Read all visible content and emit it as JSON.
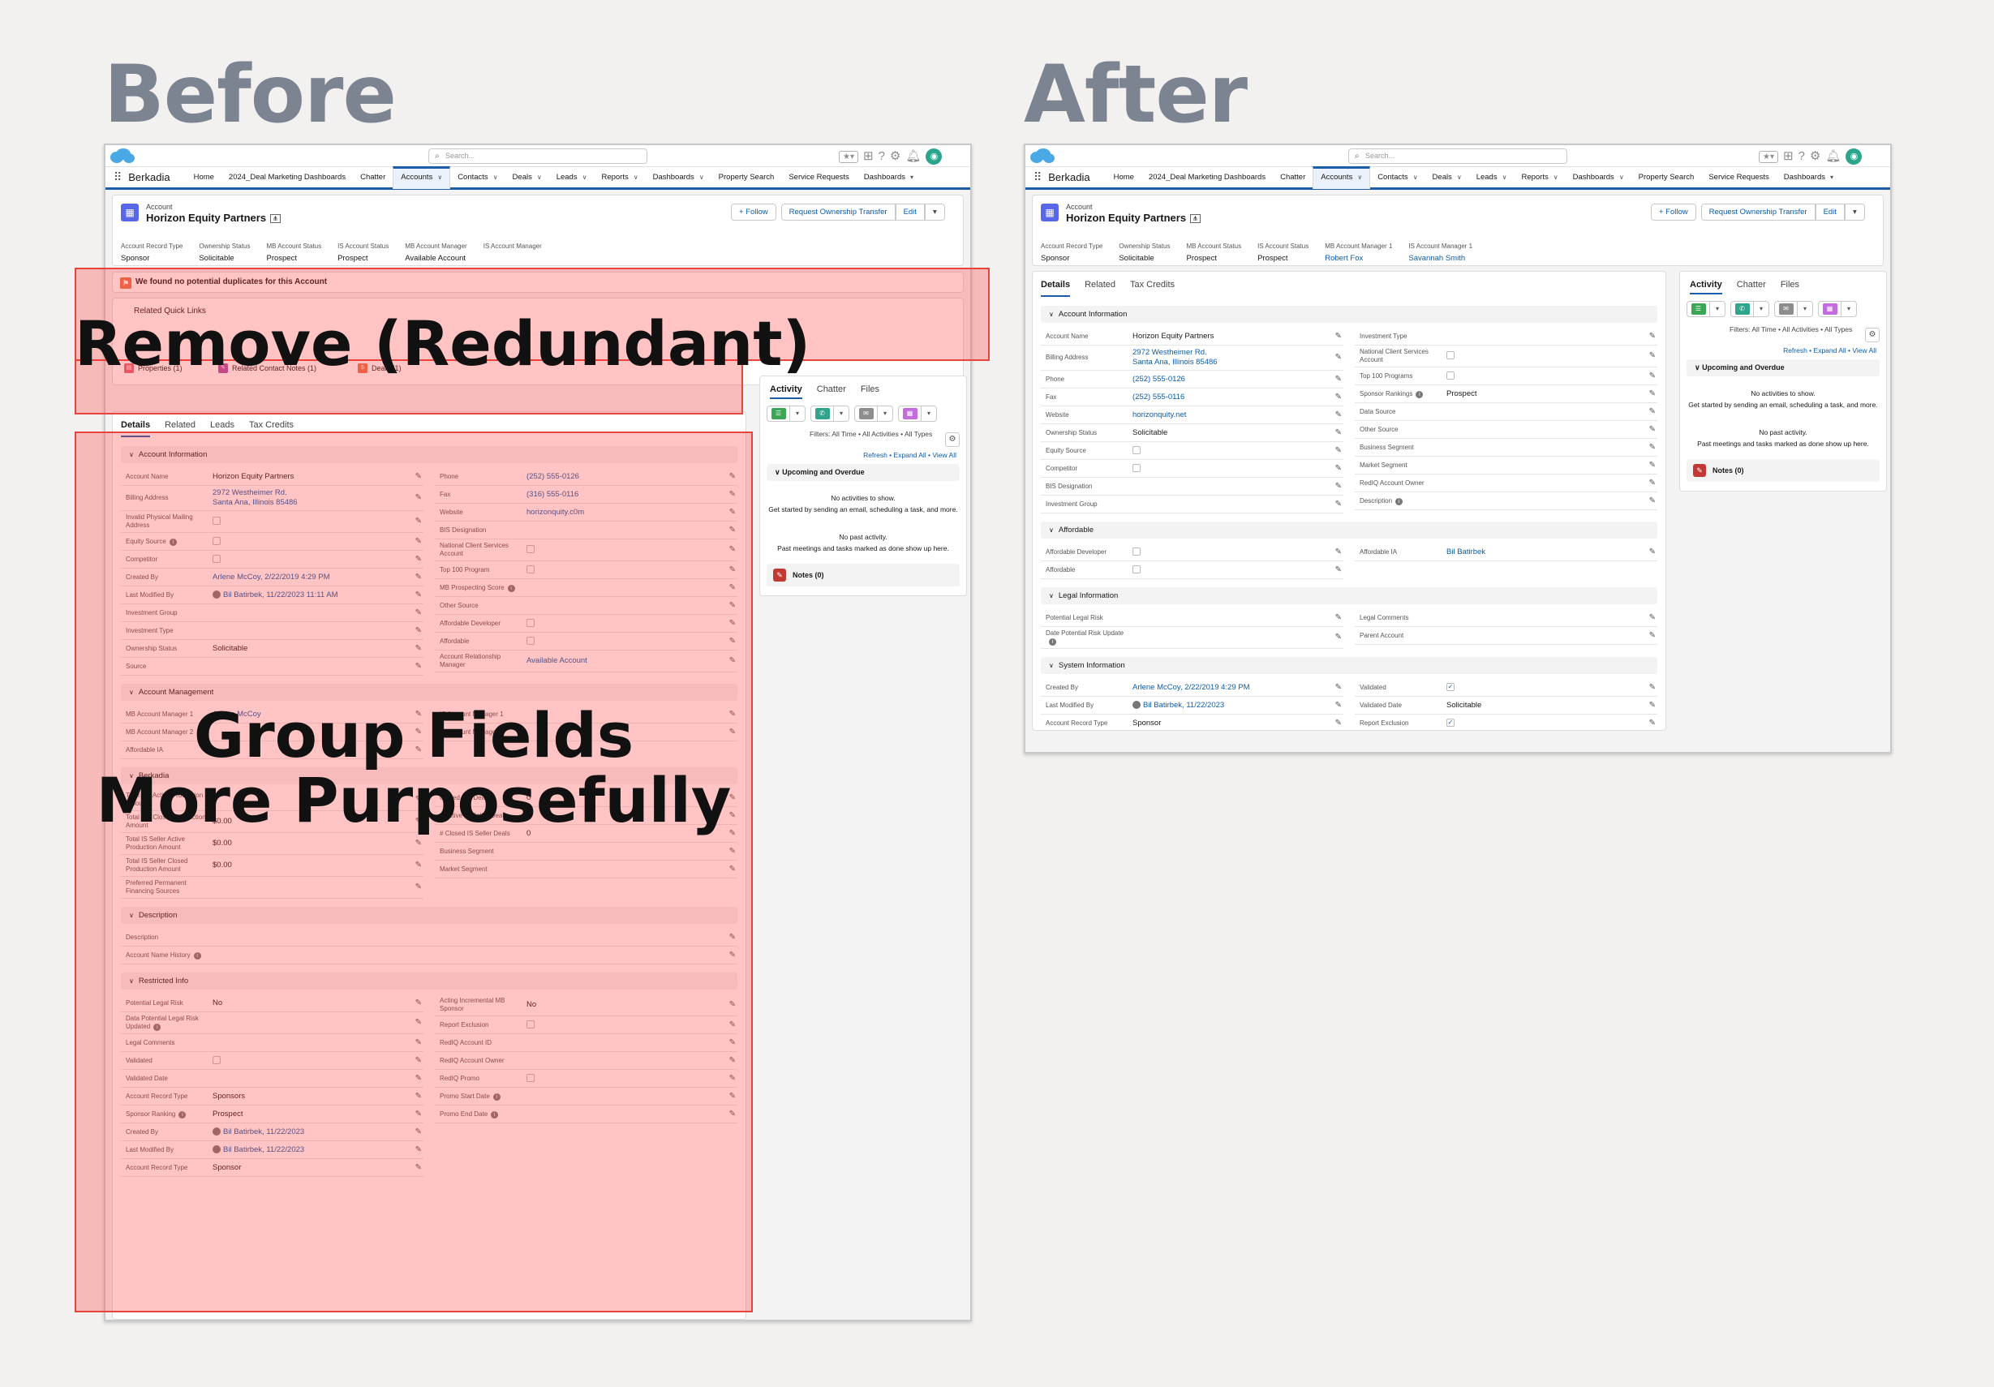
{
  "headings": {
    "before": "Before",
    "after": "After"
  },
  "app": {
    "name": "Berkadia",
    "search_placeholder": "Search...",
    "nav": [
      "Home",
      "2024_Deal Marketing Dashboards",
      "Chatter",
      "Accounts",
      "Contacts",
      "Deals",
      "Leads",
      "Reports",
      "Dashboards",
      "Property Search",
      "Service Requests",
      "Dashboards"
    ]
  },
  "record": {
    "type": "Account",
    "name": "Horizon Equity Partners",
    "buttons": {
      "follow": "+ Follow",
      "transfer": "Request Ownership Transfer",
      "edit": "Edit"
    }
  },
  "before": {
    "highlights": [
      {
        "label": "Account Record Type",
        "value": "Sponsor"
      },
      {
        "label": "Ownership Status",
        "value": "Solicitable"
      },
      {
        "label": "MB Account Status",
        "value": "Prospect"
      },
      {
        "label": "IS Account Status",
        "value": "Prospect"
      },
      {
        "label": "MB Account Manager",
        "value": "Available Account"
      },
      {
        "label": "IS Account Manager",
        "value": ""
      }
    ],
    "duplicate_banner": "We found no potential duplicates for this Account",
    "quick_links_title": "Related Quick Links",
    "quick_links": [
      "Properties (1)",
      "Related Contact Notes (1)",
      "Deals (1)"
    ],
    "tabs": [
      "Details",
      "Related",
      "Leads",
      "Tax Credits"
    ],
    "sections": {
      "account_info": "Account Information",
      "account_mgmt": "Account Management",
      "berkadia": "Berkadia",
      "description": "Description",
      "restricted": "Restricted Info"
    },
    "info_left": [
      {
        "label": "Account Name",
        "value": "Horizon Equity Partners"
      },
      {
        "label": "Billing Address",
        "value": "2972 Westheimer Rd.\nSanta Ana, Illinois 85486",
        "link": true
      },
      {
        "label": "Invalid Physical Mailing Address",
        "value": "",
        "cb": true
      },
      {
        "label": "Equity Source",
        "value": "",
        "cb": true,
        "info": true
      },
      {
        "label": "Competitor",
        "value": "",
        "cb": true
      },
      {
        "label": "Created By",
        "value": "Arlene McCoy, 2/22/2019 4:29 PM",
        "link": true
      },
      {
        "label": "Last Modified By",
        "value": "Bil Batirbek, 11/22/2023 11:11 AM",
        "link": true,
        "user": true
      },
      {
        "label": "Investment Group",
        "value": ""
      },
      {
        "label": "Investment Type",
        "value": ""
      },
      {
        "label": "Ownership Status",
        "value": "Solicitable"
      },
      {
        "label": "Source",
        "value": ""
      }
    ],
    "info_right": [
      {
        "label": "Phone",
        "value": "(252) 555-0126",
        "link": true
      },
      {
        "label": "Fax",
        "value": "(316) 555-0116",
        "link": true
      },
      {
        "label": "Website",
        "value": "horizonquity.c0m",
        "link": true
      },
      {
        "label": "BIS Designation",
        "value": ""
      },
      {
        "label": "National Client Services Account",
        "value": "",
        "cb": true
      },
      {
        "label": "Top 100 Program",
        "value": "",
        "cb": true
      },
      {
        "label": "MB Prospecting Score",
        "value": "",
        "info": true
      },
      {
        "label": "Other Source",
        "value": ""
      },
      {
        "label": "Affordable Developer",
        "value": "",
        "cb": true
      },
      {
        "label": "Affordable",
        "value": "",
        "cb": true
      },
      {
        "label": "Account Relationship Manager",
        "value": "Available Account",
        "link": true
      }
    ],
    "mgmt_left": [
      {
        "label": "MB Account Manager 1",
        "value": "Arlene McCoy",
        "link": true
      },
      {
        "label": "MB Account Manager 2",
        "value": ""
      },
      {
        "label": "Affordable IA",
        "value": ""
      }
    ],
    "mgmt_right": [
      {
        "label": "IS Account Manager 1",
        "value": ""
      },
      {
        "label": "IS Account Manager 2",
        "value": ""
      }
    ],
    "berk_left": [
      {
        "label": "Total MB Active Production Amount",
        "value": ""
      },
      {
        "label": "Total MB Closed Production Amount",
        "value": "$0.00"
      },
      {
        "label": "Total IS Seller Active Production Amount",
        "value": "$0.00"
      },
      {
        "label": "Total IS Seller Closed Production Amount",
        "value": "$0.00"
      },
      {
        "label": "Preferred Permanent Financing Sources",
        "value": ""
      }
    ],
    "berk_right": [
      {
        "label": "Closed MB Deals",
        "value": "0"
      },
      {
        "label": "# Active IS Seller Deals",
        "value": "0"
      },
      {
        "label": "# Closed IS Seller Deals",
        "value": "0"
      },
      {
        "label": "Business Segment",
        "value": ""
      },
      {
        "label": "Market Segment",
        "value": ""
      }
    ],
    "desc": [
      {
        "label": "Description",
        "value": ""
      },
      {
        "label": "Account Name History",
        "value": "",
        "info": true
      }
    ],
    "restr_left": [
      {
        "label": "Potential Legal Risk",
        "value": "No"
      },
      {
        "label": "Data Potential Legal Risk Updated",
        "value": "",
        "info": true
      },
      {
        "label": "Legal Comments",
        "value": ""
      },
      {
        "label": "Validated",
        "value": "",
        "cb": true
      },
      {
        "label": "Validated Date",
        "value": ""
      },
      {
        "label": "Account Record Type",
        "value": "Sponsors"
      },
      {
        "label": "Sponsor Ranking",
        "value": "Prospect",
        "info": true
      },
      {
        "label": "Created By",
        "value": "Bil Batirbek, 11/22/2023",
        "link": true,
        "user": true
      },
      {
        "label": "Last Modified By",
        "value": "Bil Batirbek, 11/22/2023",
        "link": true,
        "user": true
      },
      {
        "label": "Account Record Type",
        "value": "Sponsor"
      }
    ],
    "restr_right": [
      {
        "label": "Acting Incremental MB Sponsor",
        "value": "No"
      },
      {
        "label": "Report Exclusion",
        "value": "",
        "cb": true
      },
      {
        "label": "RedIQ Account ID",
        "value": ""
      },
      {
        "label": "RedIQ Account Owner",
        "value": ""
      },
      {
        "label": "RedIQ Promo",
        "value": "",
        "cb": true
      },
      {
        "label": "Promo Start Date",
        "value": "",
        "info": true
      },
      {
        "label": "Promo End Date",
        "value": "",
        "info": true
      }
    ]
  },
  "after": {
    "highlights": [
      {
        "label": "Account Record Type",
        "value": "Sponsor"
      },
      {
        "label": "Ownership Status",
        "value": "Solicitable"
      },
      {
        "label": "MB Account Status",
        "value": "Prospect"
      },
      {
        "label": "IS Account Status",
        "value": "Prospect"
      },
      {
        "label": "MB Account Manager 1",
        "value": "Robert Fox",
        "link": true
      },
      {
        "label": "IS Account Manager 1",
        "value": "Savannah Smith",
        "link": true
      }
    ],
    "tabs": [
      "Details",
      "Related",
      "Tax Credits"
    ],
    "sections": {
      "account_info": "Account Information",
      "affordable": "Affordable",
      "legal": "Legal Information",
      "system": "System Information"
    },
    "info_left": [
      {
        "label": "Account Name",
        "value": "Horizon Equity Partners"
      },
      {
        "label": "Billing Address",
        "value": "2972 Westheimer Rd.\nSanta Ana, Illinois 85486",
        "link": true
      },
      {
        "label": "Phone",
        "value": "(252) 555-0126",
        "link": true
      },
      {
        "label": "Fax",
        "value": "(252) 555-0116",
        "link": true
      },
      {
        "label": "Website",
        "value": "horizonquity.net",
        "link": true
      },
      {
        "label": "Ownership Status",
        "value": "Solicitable"
      },
      {
        "label": "Equity Source",
        "value": "",
        "cb": true
      },
      {
        "label": "Competitor",
        "value": "",
        "cb": true
      },
      {
        "label": "BIS Designation",
        "value": ""
      },
      {
        "label": "Investment Group",
        "value": ""
      }
    ],
    "info_right": [
      {
        "label": "Investment Type",
        "value": ""
      },
      {
        "label": "National Client Services Account",
        "value": "",
        "cb": true
      },
      {
        "label": "Top 100 Programs",
        "value": "",
        "cb": true
      },
      {
        "label": "Sponsor Rankings",
        "value": "Prospect",
        "info": true
      },
      {
        "label": "Data Source",
        "value": ""
      },
      {
        "label": "Other Source",
        "value": ""
      },
      {
        "label": "Business Segment",
        "value": ""
      },
      {
        "label": "Market Segment",
        "value": ""
      },
      {
        "label": "RedIQ Account Owner",
        "value": ""
      },
      {
        "label": "Description",
        "value": "",
        "info": true
      }
    ],
    "aff_left": [
      {
        "label": "Affordable Developer",
        "value": "",
        "cb": true
      },
      {
        "label": "Affordable",
        "value": "",
        "cb": true
      }
    ],
    "aff_right": [
      {
        "label": "Affordable IA",
        "value": "Bil Batirbek",
        "link": true
      }
    ],
    "legal_left": [
      {
        "label": "Potential Legal Risk",
        "value": ""
      },
      {
        "label": "Date Potential Risk Update",
        "value": "",
        "info": true
      }
    ],
    "legal_right": [
      {
        "label": "Legal Comments",
        "value": ""
      },
      {
        "label": "Parent Account",
        "value": ""
      }
    ],
    "sys_left": [
      {
        "label": "Created By",
        "value": "Arlene McCoy, 2/22/2019 4:29 PM",
        "link": true
      },
      {
        "label": "Last Modified By",
        "value": "Bil Batirbek, 11/22/2023",
        "link": true,
        "user": true
      },
      {
        "label": "Account Record Type",
        "value": "Sponsor"
      }
    ],
    "sys_right": [
      {
        "label": "Validated",
        "value": "",
        "cb": true,
        "checked": true
      },
      {
        "label": "Validated Date",
        "value": "Solicitable"
      },
      {
        "label": "Report Exclusion",
        "value": "",
        "cb": true,
        "checked": true
      }
    ]
  },
  "activity": {
    "tabs": [
      "Activity",
      "Chatter",
      "Files"
    ],
    "filters": "Filters: All Time • All Activities • All Types",
    "links": "Refresh • Expand All • View All",
    "upcoming": "Upcoming and Overdue",
    "no_activities": "No activities to show.",
    "get_started": "Get started by sending an email, scheduling a task, and more.",
    "no_past": "No past activity.",
    "past_hint": "Past meetings and tasks marked as done show up here.",
    "notes": "Notes (0)"
  },
  "overlays": {
    "remove": "Remove (Redundant)",
    "group_line1": "Group Fields",
    "group_line2": "More Purposefully"
  },
  "colors": {
    "overlay": "#e8443e",
    "brand": "#1b5ea7",
    "link": "#0b5cab",
    "heading": "#7d8491"
  }
}
